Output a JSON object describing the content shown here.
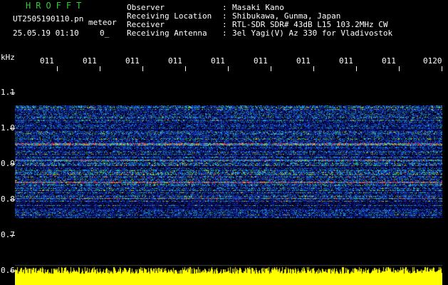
{
  "header": {
    "title": "HROFFT",
    "filename": "UT2505190110.pn",
    "type_label": "meteor",
    "date_time": "25.05.19 01:10",
    "extra": "0_"
  },
  "info": [
    {
      "label": "Observer",
      "value": "Masaki Kano"
    },
    {
      "label": "Receiving Location",
      "value": "Shibukawa, Gunma, Japan"
    },
    {
      "label": "Receiver",
      "value": "RTL-SDR SDR# 43dB L15 103.2MHz CW"
    },
    {
      "label": "Receiving Antenna",
      "value": "3el Yagi(V) Az 330 for Vladivostok"
    }
  ],
  "info_separator": ":",
  "y_axis": {
    "unit": "kHz",
    "labels": [
      "1.1",
      "1.0",
      "0.9",
      "0.8",
      "0.7",
      "0.6"
    ]
  },
  "x_axis": {
    "labels": [
      "011",
      "011",
      "011",
      "011",
      "011",
      "011",
      "011",
      "011",
      "011",
      "0120"
    ]
  },
  "colors": {
    "background": "#000000",
    "title": "#33cc33",
    "text": "#ffffff",
    "noise_floor": "#0a0a6e",
    "signal_strong": "#ff2020",
    "amplitude": "#ffff00"
  }
}
